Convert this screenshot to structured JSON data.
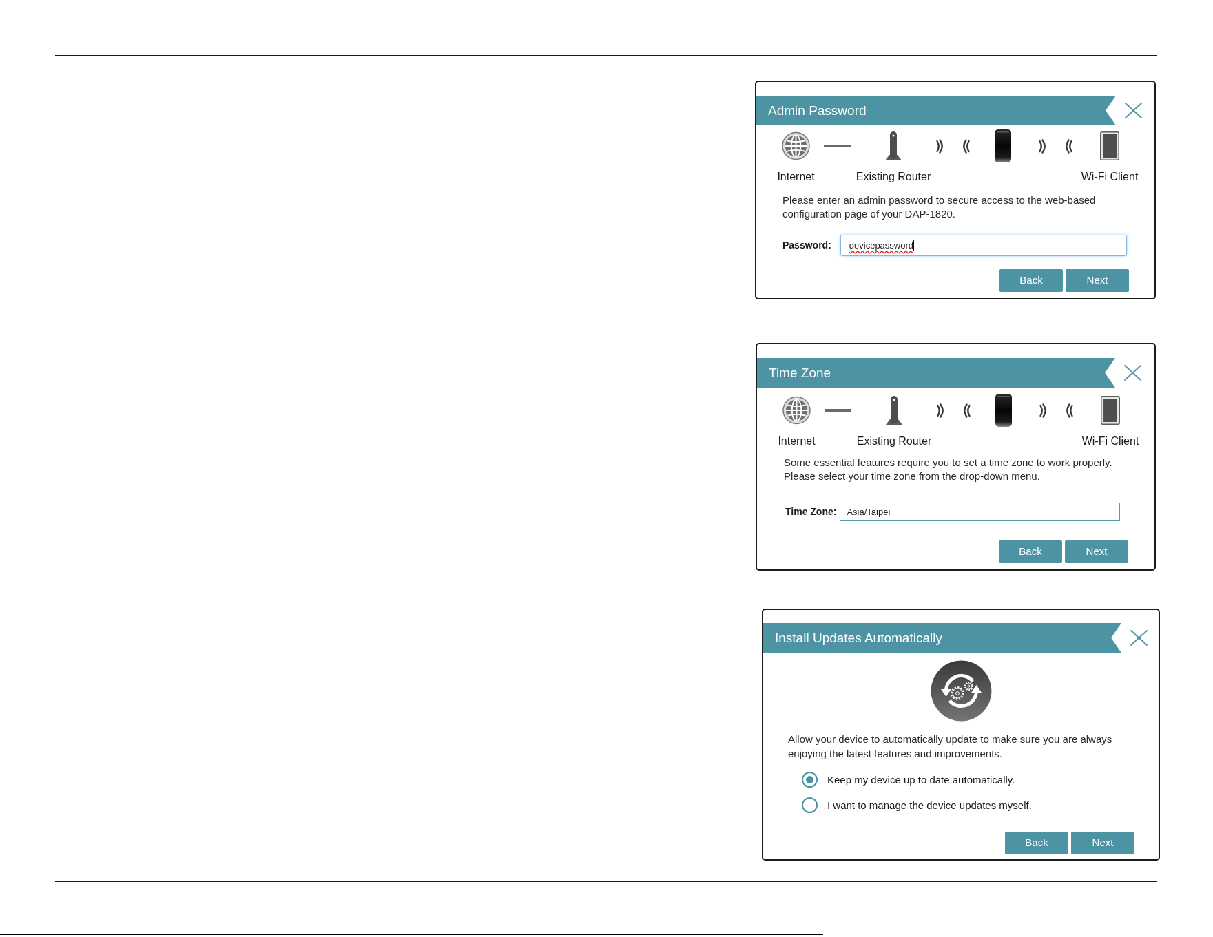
{
  "panels": [
    {
      "kind": "topology",
      "title": "Admin Password",
      "diagram_labels": [
        "Internet",
        "Existing Router",
        "Wi-Fi Client"
      ],
      "description": "Please enter an admin password to secure access to the web-based\nconfiguration page of your DAP-1820.",
      "field": {
        "kind": "password",
        "label": "Password:",
        "value": "devicepassword",
        "focused": true,
        "misspelled": true
      },
      "buttons": [
        "Back",
        "Next"
      ]
    },
    {
      "kind": "topology",
      "title": "Time Zone",
      "diagram_labels": [
        "Internet",
        "Existing Router",
        "Wi-Fi Client"
      ],
      "description": "Some essential features require you to set a time zone to work properly.\nPlease select your time zone from the drop-down menu.",
      "field": {
        "kind": "select",
        "label": "Time Zone:",
        "value": "Asia/Taipei",
        "focused": false,
        "misspelled": false
      },
      "buttons": [
        "Back",
        "Next"
      ]
    },
    {
      "kind": "update",
      "title": "Install Updates Automatically",
      "description": "Allow your device to automatically update to make sure you are always\nenjoying the latest features and improvements.",
      "options": [
        {
          "label": "Keep my device up to date automatically.",
          "selected": true
        },
        {
          "label": "I want to manage the device updates myself.",
          "selected": false
        }
      ],
      "buttons": [
        "Back",
        "Next"
      ]
    }
  ]
}
